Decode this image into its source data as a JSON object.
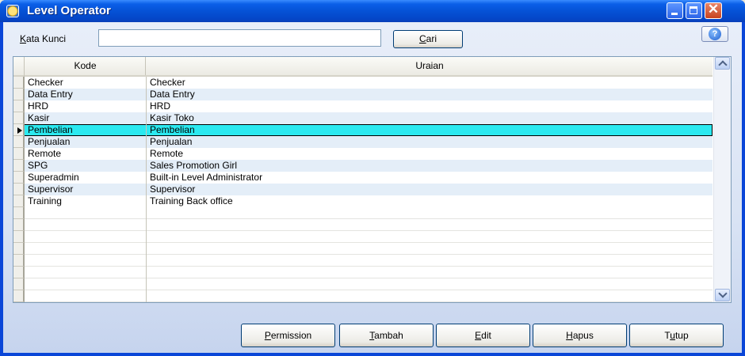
{
  "window": {
    "title": "Level Operator"
  },
  "search": {
    "label": "Kata Kunci",
    "value": "",
    "button_label": "Cari"
  },
  "grid": {
    "columns": [
      "Kode",
      "Uraian"
    ],
    "rows": [
      {
        "kode": "Checker",
        "uraian": "Checker"
      },
      {
        "kode": "Data Entry",
        "uraian": "Data Entry"
      },
      {
        "kode": "HRD",
        "uraian": "HRD"
      },
      {
        "kode": "Kasir",
        "uraian": "Kasir Toko"
      },
      {
        "kode": "Pembelian",
        "uraian": "Pembelian"
      },
      {
        "kode": "Penjualan",
        "uraian": "Penjualan"
      },
      {
        "kode": "Remote",
        "uraian": "Remote"
      },
      {
        "kode": "SPG",
        "uraian": "Sales Promotion Girl"
      },
      {
        "kode": "Superadmin",
        "uraian": "Built-in Level Administrator"
      },
      {
        "kode": "Supervisor",
        "uraian": "Supervisor"
      },
      {
        "kode": "Training",
        "uraian": "Training Back office"
      }
    ],
    "selected_row": 4
  },
  "buttons": {
    "permission": "Permission",
    "tambah": "Tambah",
    "edit": "Edit",
    "hapus": "Hapus",
    "tutup": "Tutup"
  },
  "colors": {
    "title_bar": "#0552D6",
    "selected_row": "#2BE9F0",
    "alt_row": "#E4EEF8"
  },
  "icons": [
    "app-icon",
    "minimize-icon",
    "maximize-icon",
    "close-icon",
    "help-icon",
    "scroll-up-icon",
    "scroll-down-icon",
    "row-pointer-icon"
  ]
}
